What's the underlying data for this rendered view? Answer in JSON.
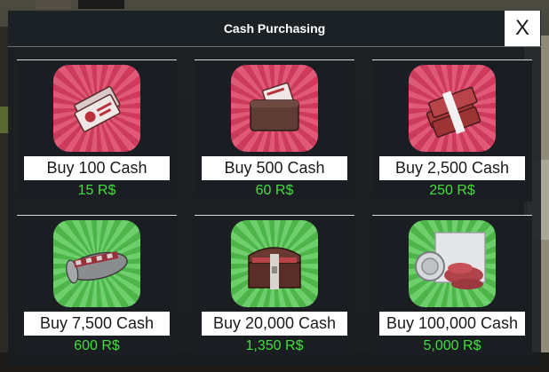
{
  "window": {
    "title": "Cash Purchasing",
    "close_label": "X"
  },
  "items": [
    {
      "label": "Buy 100 Cash",
      "price": "15 R$",
      "theme": "red",
      "icon": "cash-bills-icon"
    },
    {
      "label": "Buy 500 Cash",
      "price": "60 R$",
      "theme": "red",
      "icon": "cash-wallet-icon"
    },
    {
      "label": "Buy 2,500 Cash",
      "price": "250 R$",
      "theme": "red",
      "icon": "cash-stacks-icon"
    },
    {
      "label": "Buy 7,500 Cash",
      "price": "600 R$",
      "theme": "green",
      "icon": "cash-duffel-bag-icon"
    },
    {
      "label": "Buy 20,000 Cash",
      "price": "1,350 R$",
      "theme": "green",
      "icon": "treasure-chest-icon"
    },
    {
      "label": "Buy 100,000 Cash",
      "price": "5,000 R$",
      "theme": "green",
      "icon": "cash-vault-icon"
    }
  ],
  "colors": {
    "panel": "#181c20",
    "price_green": "#3fe03a",
    "red_tile": "#e05a78",
    "green_tile": "#6fcf6c"
  }
}
